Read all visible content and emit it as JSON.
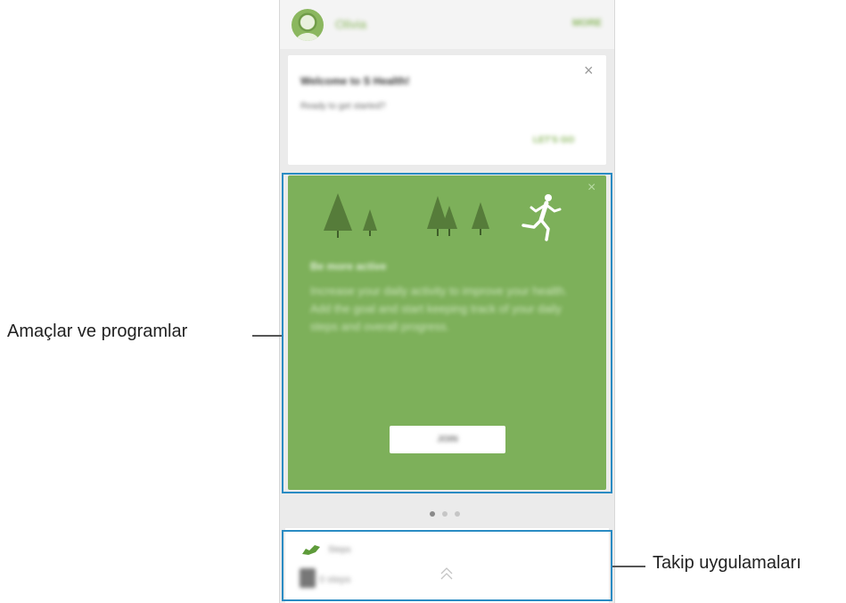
{
  "header": {
    "username": "Olivia",
    "more_label": "MORE"
  },
  "welcome_card": {
    "title": "Welcome to S Health!",
    "text": "Ready to get started?",
    "action_label": "LET'S GO",
    "close_symbol": "×"
  },
  "goal_card": {
    "title": "Be more active",
    "description": "Increase your daily activity to improve your health. Add the goal and start keeping track of your daily steps and overall progress.",
    "button_label": "JOIN",
    "close_symbol": "×"
  },
  "pager": {
    "count": 3,
    "active_index": 0
  },
  "tracker_card": {
    "label": "Steps",
    "value": "0 steps"
  },
  "callouts": {
    "goals": "Amaçlar ve programlar",
    "tracker": "Takip uygulamaları"
  },
  "colors": {
    "accent_green": "#7db05a",
    "highlight_blue": "#2a8bc3"
  }
}
